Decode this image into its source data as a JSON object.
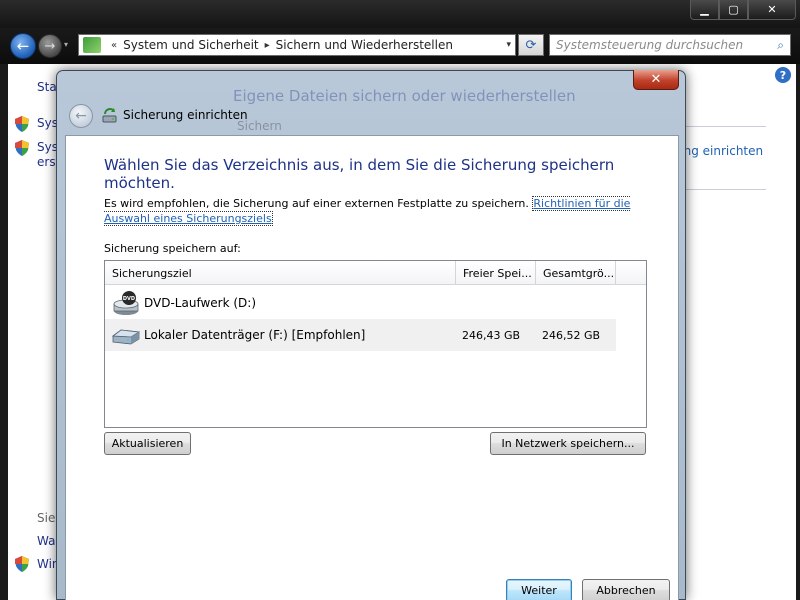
{
  "outer": {
    "caption": {
      "minimize": "▁",
      "maximize": "▢",
      "close": "✕"
    },
    "nav": {
      "back_icon": "←",
      "forward_icon": "→",
      "history_icon": "▾",
      "address_prefix": "«",
      "breadcrumbs": [
        "System und Sicherheit",
        "Sichern und Wiederherstellen"
      ],
      "address_dropdown": "▾",
      "refresh_icon": "⟳",
      "search_placeholder": "Systemsteuerung durchsuchen",
      "search_icon": "⌕"
    },
    "help_icon": "?",
    "left_pane": {
      "start_link": "Start",
      "items": [
        "Syst",
        "Syst",
        "erst"
      ],
      "see_also": "Sieh",
      "bottom_items": [
        "Wart",
        "Win"
      ]
    },
    "background": {
      "heading": "Eigene Dateien sichern oder wiederherstellen",
      "sub": "Sichern",
      "setup_link": "ung einrichten"
    }
  },
  "dialog": {
    "close_label": "✕",
    "title": "Sicherung einrichten",
    "instruction": "Wählen Sie das Verzeichnis aus, in dem Sie die Sicherung speichern möchten.",
    "recommendation": "Es wird empfohlen, die Sicherung auf einer externen Festplatte zu speichern.",
    "guideline_link": "Richtlinien für die Auswahl eines Sicherungsziels",
    "save_label": "Sicherung speichern auf:",
    "list": {
      "columns": [
        "Sicherungsziel",
        "Freier Spei...",
        "Gesamtgrö..."
      ],
      "rows": [
        {
          "name": "DVD-Laufwerk (D:)",
          "free": "",
          "total": "",
          "icon": "dvd-drive-icon"
        },
        {
          "name": "Lokaler Datenträger (F:) [Empfohlen]",
          "free": "246,43 GB",
          "total": "246,52 GB",
          "icon": "hard-disk-icon"
        }
      ]
    },
    "refresh_button": "Aktualisieren",
    "network_button": "In Netzwerk speichern...",
    "next_button": "Weiter",
    "cancel_button": "Abbrechen"
  }
}
